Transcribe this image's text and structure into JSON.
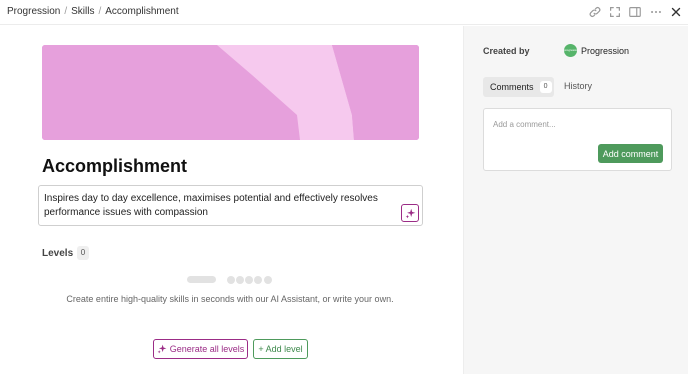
{
  "breadcrumb": [
    "Progression",
    "Skills",
    "Accomplishment"
  ],
  "breadcrumb_separator": "/",
  "toolbar": {
    "icons": [
      "link-icon",
      "expand-icon",
      "side-panel-icon",
      "more-icon",
      "close-icon"
    ]
  },
  "skill": {
    "title": "Accomplishment",
    "description": "Inspires day to day excellence, maximises potential and effectively resolves performance issues with compassion"
  },
  "levels": {
    "label": "Levels",
    "count": "0",
    "empty_hint": "Create entire high-quality skills in seconds with our AI Assistant, or write your own.",
    "generate_label": "Generate all levels",
    "add_label": "+ Add level"
  },
  "sidebar": {
    "created_by_label": "Created by",
    "creator": "Progression",
    "avatar_text": "progression",
    "tabs": {
      "comments": "Comments",
      "comments_count": "0",
      "history": "History"
    },
    "comment_placeholder": "Add a comment...",
    "add_comment_label": "Add comment"
  },
  "colors": {
    "accent_purple": "#9b2c86",
    "accent_green": "#4e9a5c",
    "banner_pink": "#e6a0dc",
    "banner_light": "#f6c9ee"
  }
}
